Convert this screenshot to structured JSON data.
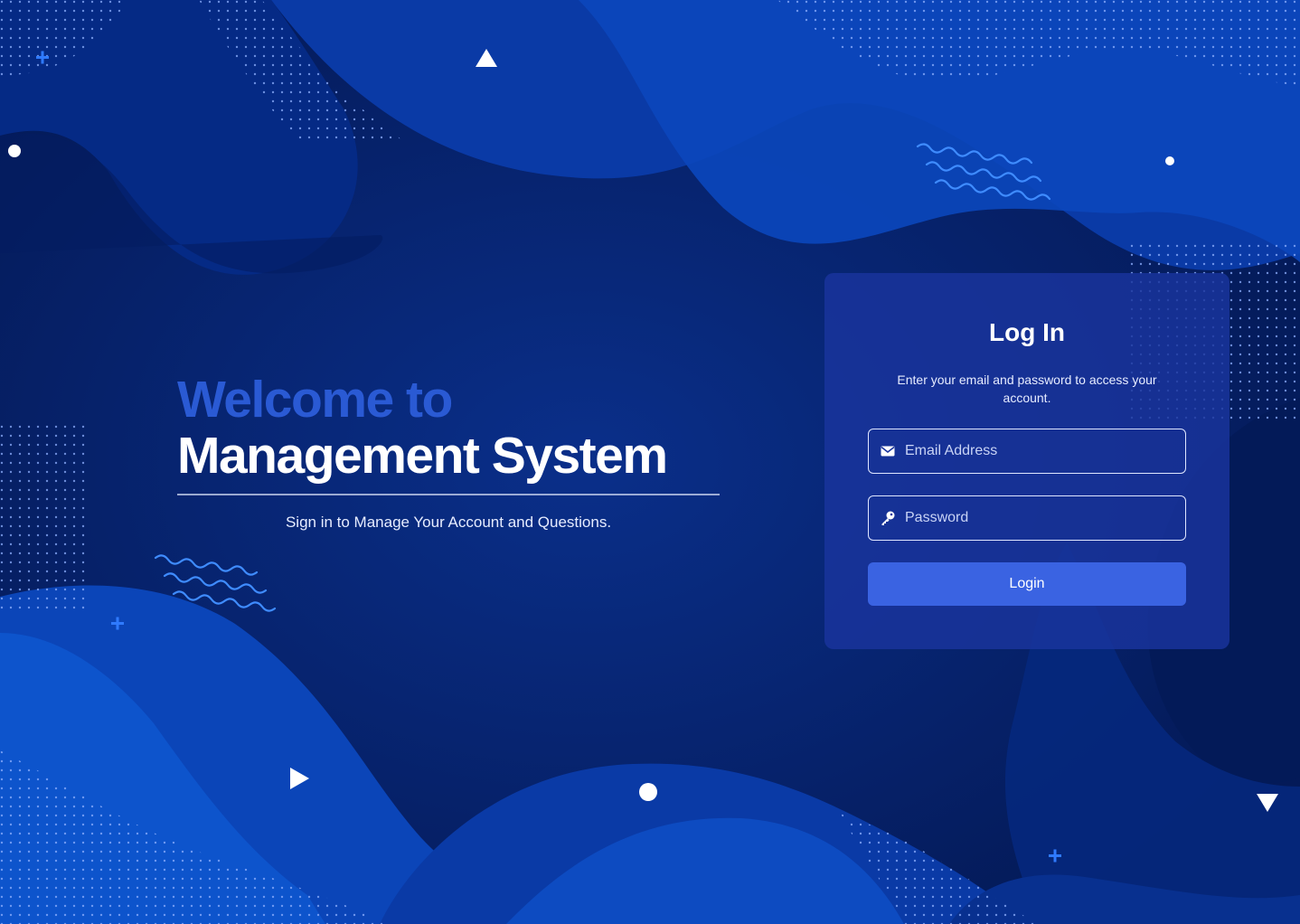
{
  "hero": {
    "line1": "Welcome to",
    "line2": "Management System",
    "subtitle": "Sign in to Manage Your Account and Questions."
  },
  "login_card": {
    "title": "Log In",
    "subtitle": "Enter your email and password to access your account.",
    "email_placeholder": "Email Address",
    "password_placeholder": "Password",
    "button_label": "Login"
  },
  "icons": {
    "email": "envelope-icon",
    "password": "key-icon"
  },
  "colors": {
    "background": "#05236e",
    "accent_text": "#2a5ad4",
    "button": "#3a63e2",
    "card": "#1a349e"
  }
}
